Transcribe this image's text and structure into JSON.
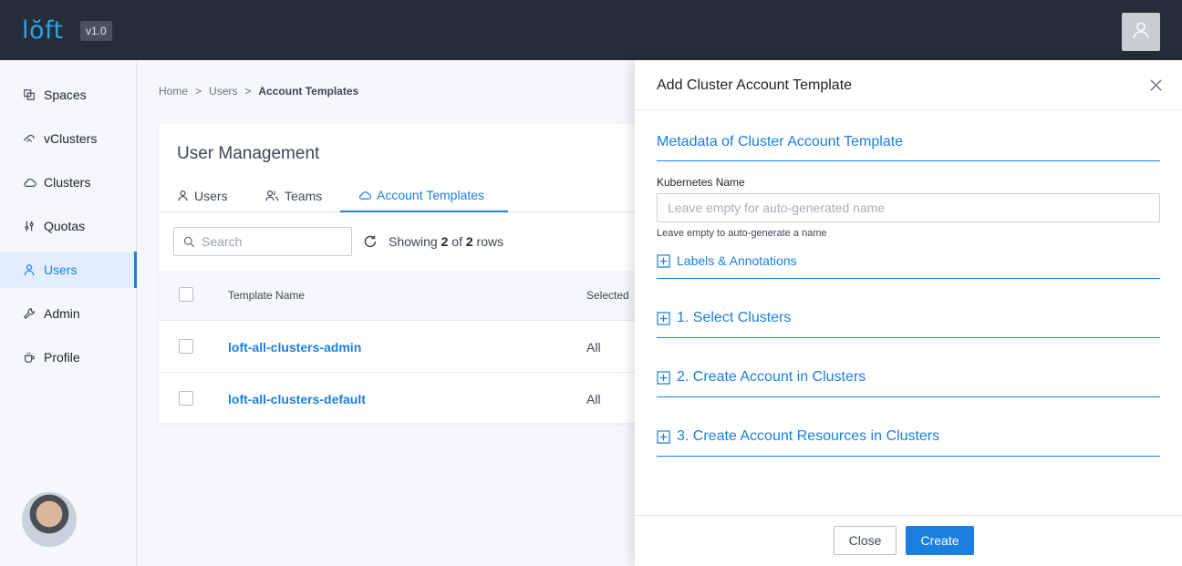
{
  "app": {
    "logo": "lŏft",
    "version": "v1.0"
  },
  "sidebar": {
    "items": [
      {
        "label": "Spaces",
        "icon": "spaces-icon"
      },
      {
        "label": "vClusters",
        "icon": "vcluster-icon"
      },
      {
        "label": "Clusters",
        "icon": "cloud-icon"
      },
      {
        "label": "Quotas",
        "icon": "sliders-icon"
      },
      {
        "label": "Users",
        "icon": "user-icon",
        "active": true
      },
      {
        "label": "Admin",
        "icon": "wrench-icon"
      },
      {
        "label": "Profile",
        "icon": "coffee-icon"
      }
    ]
  },
  "breadcrumb": {
    "home": "Home",
    "sep": ">",
    "users": "Users",
    "current": "Account Templates"
  },
  "card": {
    "title": "User Management",
    "tabs": [
      {
        "label": "Users",
        "icon": "user-icon"
      },
      {
        "label": "Teams",
        "icon": "team-icon"
      },
      {
        "label": "Account Templates",
        "icon": "cloud-icon",
        "active": true
      }
    ],
    "search_placeholder": "Search",
    "showing_prefix": "Showing",
    "showing_count": "2",
    "showing_of": "of",
    "showing_total": "2",
    "showing_suffix": "rows",
    "columns": {
      "name": "Template Name",
      "selected": "Selected"
    },
    "rows": [
      {
        "name": "loft-all-clusters-admin",
        "value": "All"
      },
      {
        "name": "loft-all-clusters-default",
        "value": "All"
      }
    ]
  },
  "drawer": {
    "title": "Add Cluster Account Template",
    "metadata_title": "Metadata of Cluster Account Template",
    "k8s_name_label": "Kubernetes Name",
    "k8s_name_placeholder": "Leave empty for auto-generated name",
    "k8s_name_value": "",
    "k8s_name_hint": "Leave empty to auto-generate a name",
    "labels_annotations": "Labels & Annotations",
    "sections": [
      "1. Select Clusters",
      "2. Create Account in Clusters",
      "3. Create Account Resources in Clusters"
    ],
    "close_label": "Close",
    "create_label": "Create"
  },
  "colors": {
    "accent": "#1a7fe0",
    "topbar": "#242d38",
    "logo": "#2fa3e6"
  }
}
